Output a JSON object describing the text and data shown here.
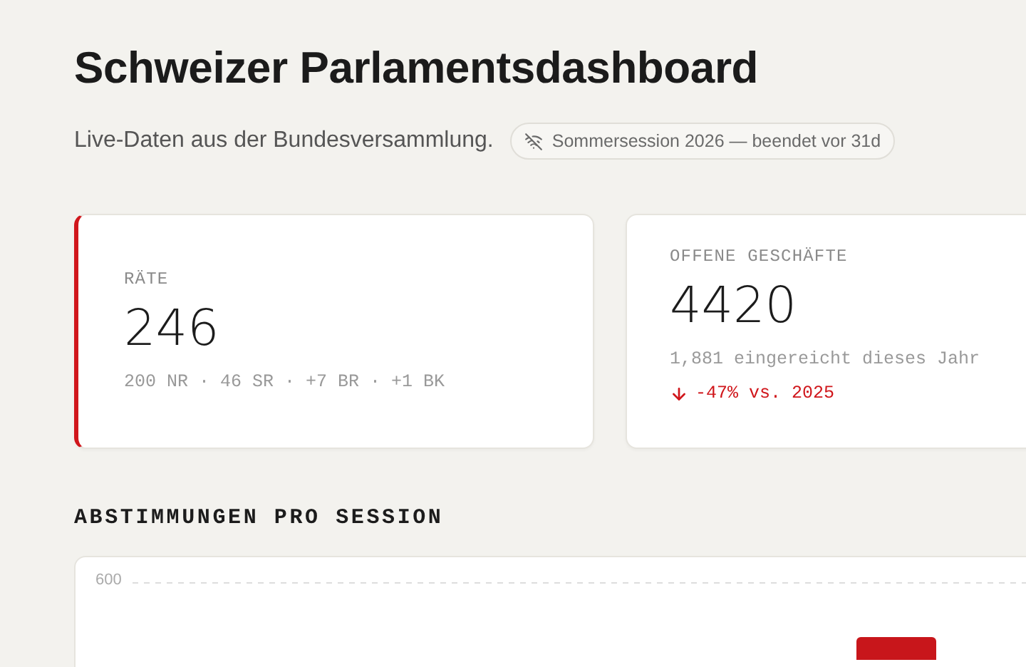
{
  "title": "Schweizer Parlamentsdashboard",
  "subtitle": "Live-Daten aus der Bundesversammlung.",
  "session_badge": {
    "label": "Sommersession 2026 — beendet vor 31d",
    "live": false
  },
  "stats": [
    {
      "label": "RÄTE",
      "value": "246",
      "detail": "200 NR · 46 SR · +7 BR · +1 BK",
      "accent": true
    },
    {
      "label": "OFFENE GESCHÄFTE",
      "value": "4420",
      "detail": "1,881 eingereicht dieses Jahr",
      "accent": false,
      "trend": {
        "negative": true,
        "text": "-47% vs. 2025"
      }
    }
  ],
  "votes_section": {
    "heading": "ABSTIMMUNGEN PRO SESSION",
    "tick_label": "600"
  }
}
